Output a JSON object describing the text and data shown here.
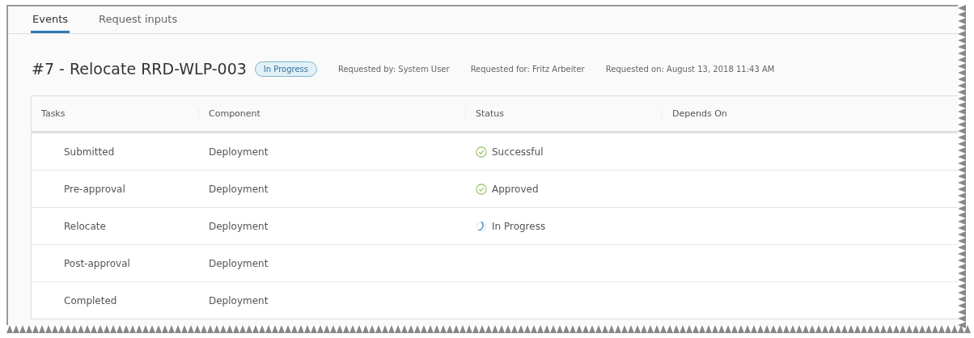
{
  "tabs": [
    {
      "label": "Events",
      "selected": true
    },
    {
      "label": "Request inputs",
      "selected": false
    }
  ],
  "request": {
    "title": "#7 - Relocate RRD-WLP-003",
    "badge": "In Progress",
    "meta": [
      "Requested by: System User",
      "Requested for: Fritz Arbeiter",
      "Requested on: August 13, 2018 11:43 AM"
    ]
  },
  "table": {
    "columns": [
      "Tasks",
      "Component",
      "Status",
      "Depends On"
    ],
    "rows": [
      {
        "task": "Submitted",
        "component": "Deployment",
        "status": {
          "kind": "success",
          "label": "Successful"
        }
      },
      {
        "task": "Pre-approval",
        "component": "Deployment",
        "status": {
          "kind": "success",
          "label": "Approved"
        }
      },
      {
        "task": "Relocate",
        "component": "Deployment",
        "status": {
          "kind": "progress",
          "label": "In Progress"
        }
      },
      {
        "task": "Post-approval",
        "component": "Deployment"
      },
      {
        "task": "Completed",
        "component": "Deployment"
      }
    ]
  }
}
